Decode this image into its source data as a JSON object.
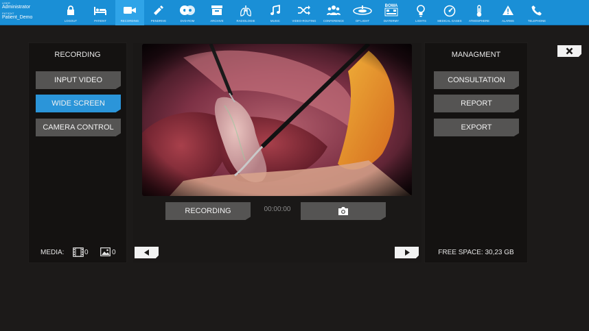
{
  "user": {
    "user_label": "USER",
    "user_name": "Administrator",
    "patient_label": "PATIENT",
    "patient_name": "Patient_Demo"
  },
  "nav": [
    {
      "label": "LOGOUT",
      "icon": "lock-icon"
    },
    {
      "label": "PATIENT",
      "icon": "bed-icon"
    },
    {
      "label": "RECORDING",
      "icon": "video-camera-icon"
    },
    {
      "label": "PENDRIVE",
      "icon": "usb-drive-icon"
    },
    {
      "label": "DVD-ROM",
      "icon": "disc-icon"
    },
    {
      "label": "ARCHIVE",
      "icon": "archive-box-icon"
    },
    {
      "label": "RADIOLOGIE",
      "icon": "lungs-icon"
    },
    {
      "label": "MUSIC",
      "icon": "music-note-icon"
    },
    {
      "label": "VIDEO-ROUTING",
      "icon": "shuffle-icon"
    },
    {
      "label": "CONFERENCE",
      "icon": "people-group-icon"
    },
    {
      "label": "OP LIGHT",
      "icon": "surgical-light-icon"
    },
    {
      "label": "DIATERMY",
      "icon": "bowa-diathermy-icon"
    },
    {
      "label": "LIGHTS",
      "icon": "light-bulb-icon"
    },
    {
      "label": "MEDICAL GASES",
      "icon": "gauge-icon"
    },
    {
      "label": "ATMOSPHERE",
      "icon": "thermometer-icon"
    },
    {
      "label": "ALARMS",
      "icon": "warning-triangle-icon"
    },
    {
      "label": "TELEPHONE",
      "icon": "phone-icon"
    }
  ],
  "nav_active_index": 2,
  "diatermy_icon_text": "BOWA",
  "left_panel": {
    "title": "RECORDING",
    "buttons": [
      "INPUT VIDEO",
      "WIDE SCREEN",
      "CAMERA CONTROL"
    ],
    "active_button": 1,
    "media_label": "MEDIA:",
    "video_count": "0",
    "image_count": "0"
  },
  "center": {
    "recording_label": "RECORDING",
    "timer": "00:00:00"
  },
  "right_panel": {
    "title": "MANAGMENT",
    "buttons": [
      "CONSULTATION",
      "REPORT",
      "EXPORT"
    ],
    "free_space": "FREE SPACE: 30,23 GB"
  },
  "colors": {
    "accent": "#2b95d9",
    "topbar": "#1a8fd6",
    "button": "#555453",
    "background": "#1c1a19"
  }
}
